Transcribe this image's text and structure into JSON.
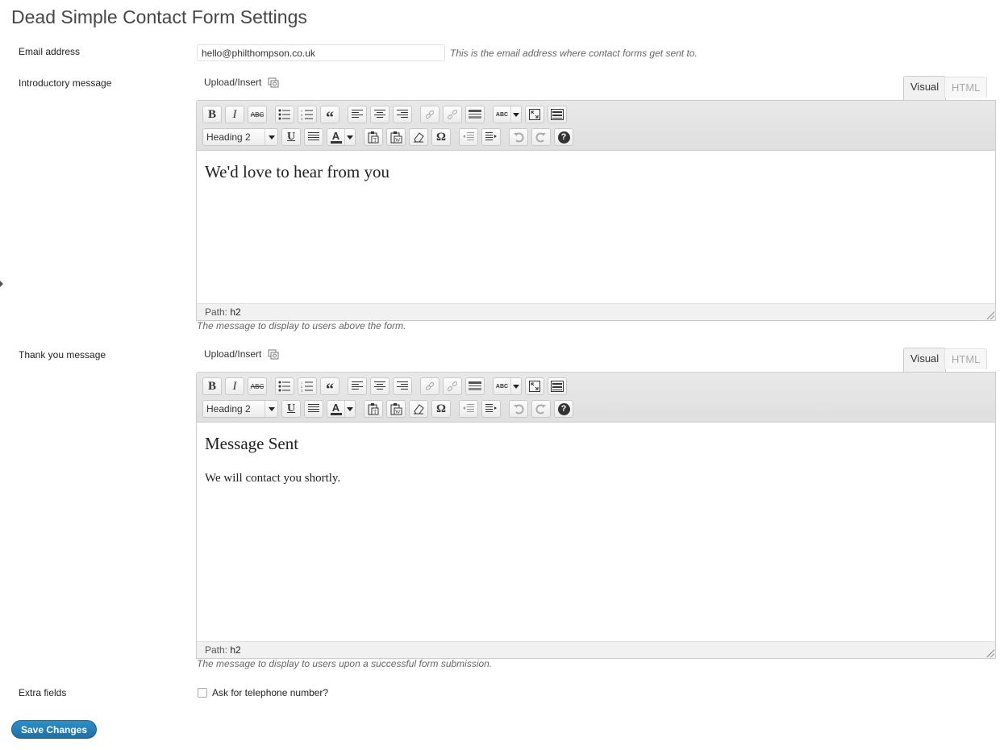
{
  "page": {
    "title": "Dead Simple Contact Form Settings"
  },
  "email": {
    "label": "Email address",
    "value": "hello@philthompson.co.uk",
    "description": "This is the email address where contact forms get sent to."
  },
  "intro": {
    "label": "Introductory message",
    "upload_label": "Upload/Insert",
    "tab_visual": "Visual",
    "tab_html": "HTML",
    "format_value": "Heading 2",
    "heading": "We'd love to hear from you",
    "path_label": "Path:",
    "path_value": "h2",
    "description": "The message to display to users above the form."
  },
  "thanks": {
    "label": "Thank you message",
    "upload_label": "Upload/Insert",
    "tab_visual": "Visual",
    "tab_html": "HTML",
    "format_value": "Heading 2",
    "heading": "Message Sent",
    "paragraph": "We will contact you shortly.",
    "path_label": "Path:",
    "path_value": "h2",
    "description": "The message to display to users upon a successful form submission."
  },
  "extra": {
    "label": "Extra fields",
    "checkbox_label": "Ask for telephone number?",
    "checked": false
  },
  "actions": {
    "save_label": "Save Changes"
  },
  "toolbar_glyphs": {
    "bold": "B",
    "italic": "I",
    "strike": "ABC",
    "quote": "“",
    "spell": "ABC",
    "underline": "U",
    "textcolor": "A",
    "omega": "Ω",
    "help": "?"
  },
  "colors": {
    "primary_button": "#2584c2",
    "link_text": "#333333"
  }
}
